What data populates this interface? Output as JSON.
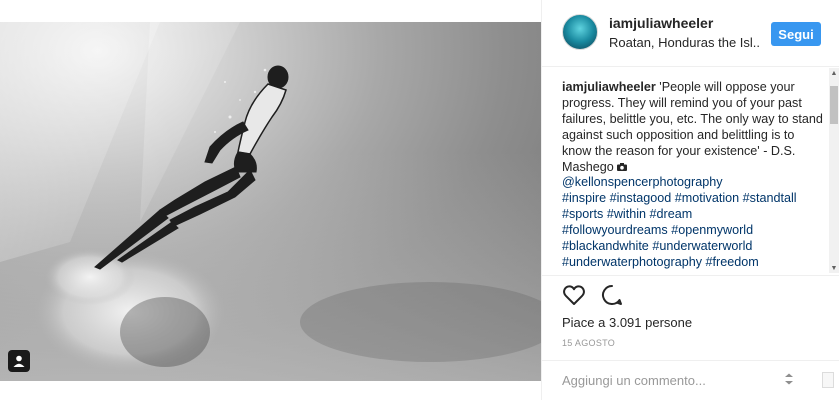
{
  "post": {
    "photo": {
      "icon": "user-tag-icon",
      "description_icon": "black-and-white-underwater-photo"
    },
    "header": {
      "username": "iamjuliawheeler",
      "location": "Roatan, Honduras the Isl...",
      "follow_label": "Segui",
      "avatar_icon": "avatar-icon"
    },
    "caption": {
      "username": "iamjuliawheeler",
      "text": "'People will oppose your progress. They will remind you of your past failures, belittle you, etc. The only way to stand against such opposition and belittling is to know the reason for your existence' - D.S. Mashego",
      "camera_icon": "camera-icon",
      "mention": "@kellonspencerphotography",
      "hashtags": [
        "#inspire",
        "#instagood",
        "#motivation",
        "#standtall",
        "#sports",
        "#within",
        "#dream",
        "#followyourdreams",
        "#openmyworld",
        "#blackandwhite",
        "#underwaterworld",
        "#underwaterphotography",
        "#freedom"
      ]
    },
    "actions": {
      "like_icon": "heart-icon",
      "comment_icon": "comment-bubble-icon"
    },
    "likes_text": "Piace a 3.091 persone",
    "date_text": "15 AGOSTO",
    "comment_box": {
      "placeholder": "Aggiungi un commento...",
      "more_icon": "more-options-icon"
    },
    "colors": {
      "accent": "#3897f0",
      "link": "#003569",
      "muted": "#999999"
    }
  }
}
